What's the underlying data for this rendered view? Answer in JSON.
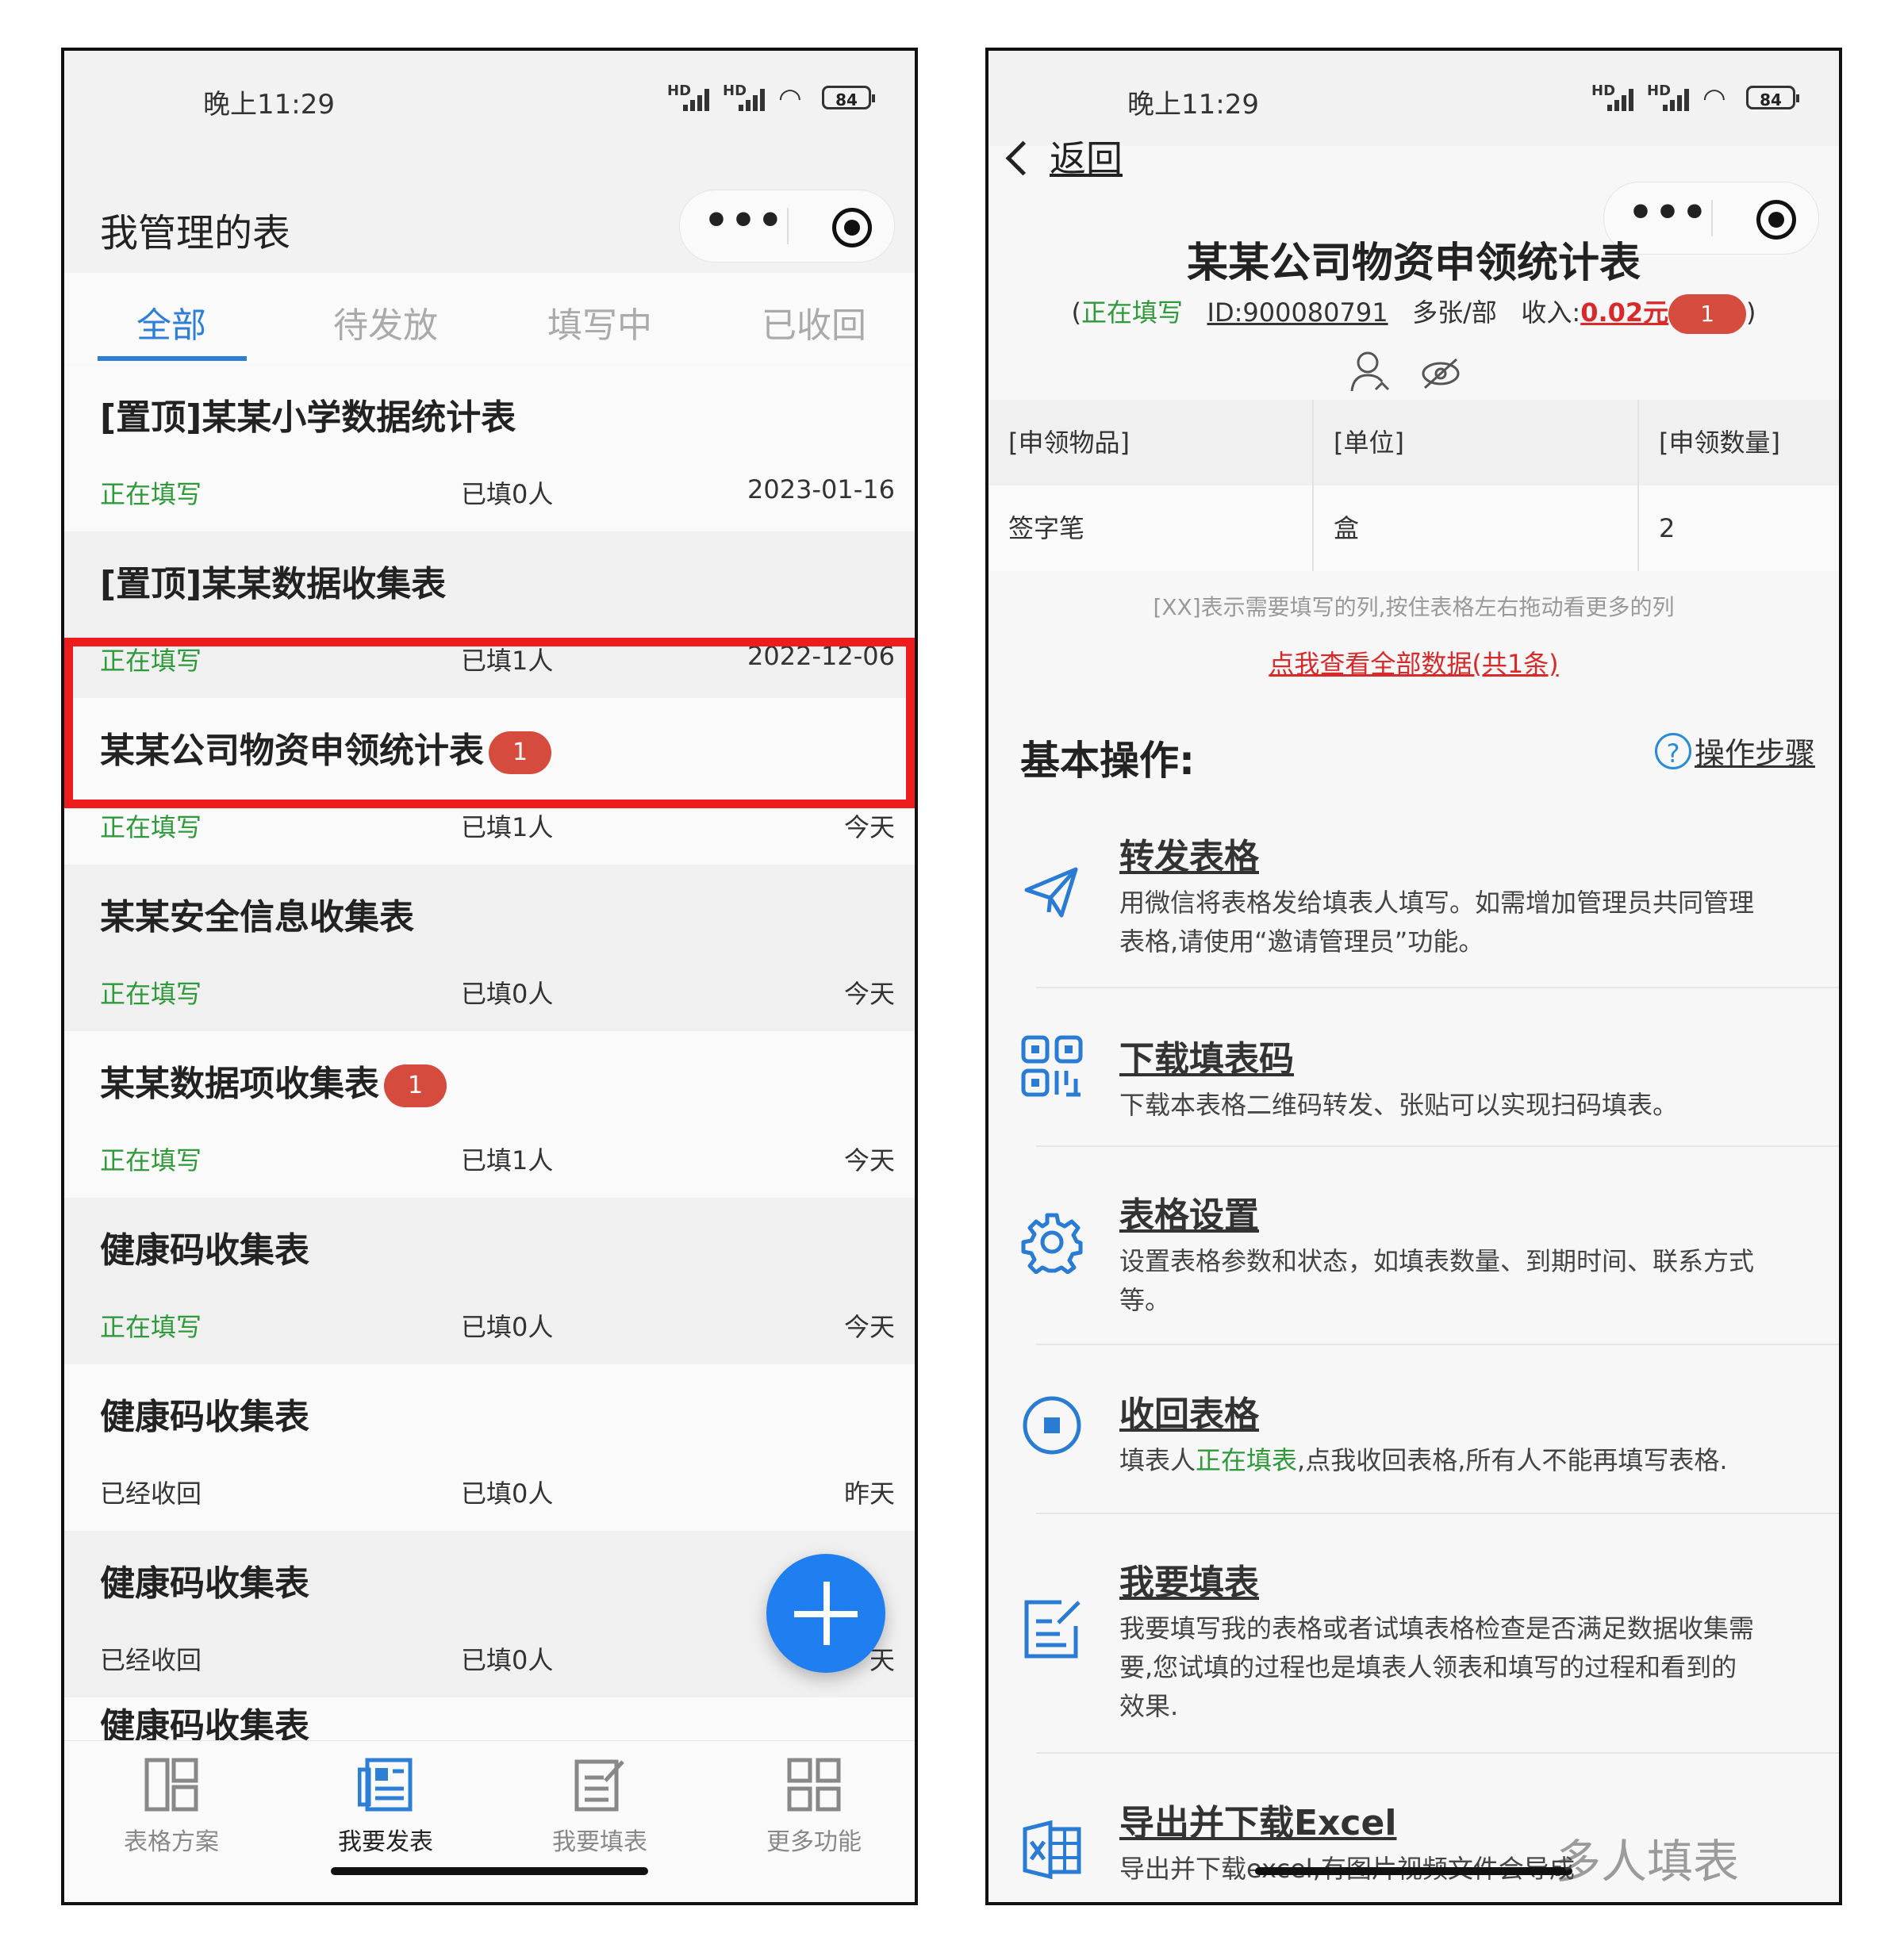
{
  "left": {
    "status": {
      "time": "晚上11:29",
      "signal_label": "HD",
      "battery": "84"
    },
    "title": "我管理的表",
    "tabs": [
      "全部",
      "待发放",
      "填写中",
      "已收回"
    ],
    "items": [
      {
        "title": "[置顶]某某小学数据统计表",
        "status": "正在填写",
        "count": "已填0人",
        "date": "2023-01-16",
        "badge": ""
      },
      {
        "title": "[置顶]某某数据收集表",
        "status": "正在填写",
        "count": "已填1人",
        "date": "2022-12-06",
        "badge": ""
      },
      {
        "title": "某某公司物资申领统计表",
        "status": "正在填写",
        "count": "已填1人",
        "date": "今天",
        "badge": "1"
      },
      {
        "title": "某某安全信息收集表",
        "status": "正在填写",
        "count": "已填0人",
        "date": "今天",
        "badge": ""
      },
      {
        "title": "某某数据项收集表",
        "status": "正在填写",
        "count": "已填1人",
        "date": "今天",
        "badge": "1"
      },
      {
        "title": "健康码收集表",
        "status": "正在填写",
        "count": "已填0人",
        "date": "今天",
        "badge": ""
      },
      {
        "title": "健康码收集表",
        "status": "已经收回",
        "count": "已填0人",
        "date": "昨天",
        "badge": ""
      },
      {
        "title": "健康码收集表",
        "status": "已经收回",
        "count": "已填0人",
        "date": "天",
        "badge": ""
      },
      {
        "title": "健康码收集表",
        "status": "",
        "count": "",
        "date": "",
        "badge": ""
      }
    ],
    "nav": [
      "表格方案",
      "我要发表",
      "我要填表",
      "更多功能"
    ]
  },
  "right": {
    "status": {
      "time": "晚上11:29",
      "signal_label": "HD",
      "battery": "84"
    },
    "back_label": "返回",
    "doc_title": "某某公司物资申领统计表",
    "meta": {
      "open": "(",
      "state": "正在填写",
      "id": "ID:900080791",
      "mode": "多张/部",
      "income_label": "收入:",
      "income": "0.02元",
      "badge": "1",
      "close": ")"
    },
    "table": {
      "headers": [
        "[申领物品]",
        "[单位]",
        "[申领数量]"
      ],
      "row": [
        "签字笔",
        "盒",
        "2"
      ]
    },
    "hint": "[XX]表示需要填写的列,按住表格左右拖动看更多的列",
    "view_all": "点我查看全部数据(共1条)",
    "section_title": "基本操作:",
    "help_label": "操作步骤",
    "ops": [
      {
        "title": "转发表格",
        "desc": "用微信将表格发给填表人填写。如需增加管理员共同管理表格,请使用“邀请管理员”功能。"
      },
      {
        "title": "下载填表码",
        "desc": "下载本表格二维码转发、张贴可以实现扫码填表。"
      },
      {
        "title": "表格设置",
        "desc": "设置表格参数和状态，如填表数量、到期时间、联系方式等。"
      },
      {
        "title": "收回表格",
        "desc_pre": "填表人",
        "desc_green": "正在填表",
        "desc_post": ",点我收回表格,所有人不能再填写表格."
      },
      {
        "title": "我要填表",
        "desc": "我要填写我的表格或者试填表格检查是否满足数据收集需要,您试填的过程也是填表人领表和填写的过程和看到的效果."
      },
      {
        "title": "导出并下载Excel",
        "desc": "导出并下载excel,有图片视频文件会导成"
      }
    ]
  },
  "watermark": "多人填表",
  "colors": {
    "accent_blue": "#2d7fd6",
    "status_green": "#2e9a3a",
    "badge_red": "#d54b3d",
    "highlight_red": "#ee1c1c",
    "fab_blue": "#1f7ef0"
  }
}
